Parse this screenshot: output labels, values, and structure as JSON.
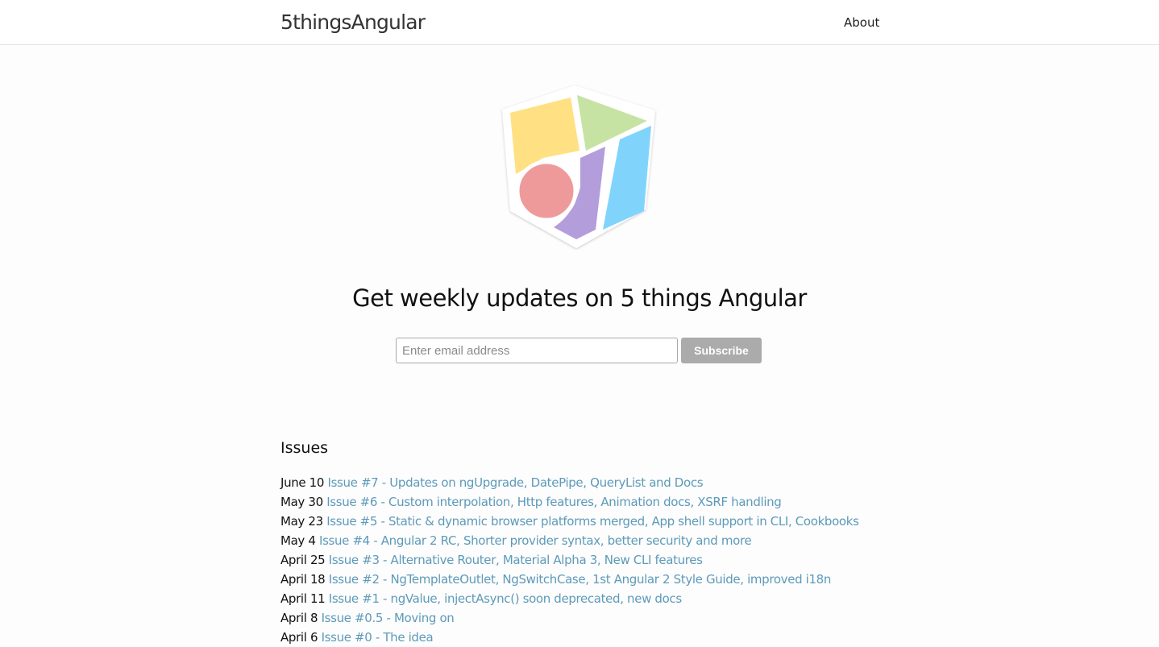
{
  "header": {
    "site_title": "5thingsAngular",
    "nav": [
      {
        "label": "About"
      }
    ]
  },
  "logo": {
    "colors": {
      "yellow": "#ffe083",
      "green": "#c6e3a4",
      "blue": "#80d4fc",
      "purple": "#b39ddb",
      "red": "#ef9a9a",
      "outline": "#ffffff"
    }
  },
  "hero": {
    "headline": "Get weekly updates on 5 things Angular"
  },
  "subscribe": {
    "email_placeholder": "Enter email address",
    "email_value": "",
    "button_label": "Subscribe",
    "button_color": "#ababab"
  },
  "issues": {
    "heading": "Issues",
    "link_color": "#5d9ab9",
    "items": [
      {
        "date": "June 10",
        "title": "Issue #7 - Updates on ngUpgrade, DatePipe, QueryList and Docs"
      },
      {
        "date": "May 30",
        "title": "Issue #6 - Custom interpolation, Http features, Animation docs, XSRF handling"
      },
      {
        "date": "May 23",
        "title": "Issue #5 - Static & dynamic browser platforms merged, App shell support in CLI, Cookbooks"
      },
      {
        "date": "May 4",
        "title": "Issue #4 - Angular 2 RC, Shorter provider syntax, better security and more"
      },
      {
        "date": "April 25",
        "title": "Issue #3 - Alternative Router, Material Alpha 3, New CLI features"
      },
      {
        "date": "April 18",
        "title": "Issue #2 - NgTemplateOutlet, NgSwitchCase, 1st Angular 2 Style Guide, improved i18n"
      },
      {
        "date": "April 11",
        "title": "Issue #1 - ngValue, injectAsync() soon deprecated, new docs"
      },
      {
        "date": "April 8",
        "title": "Issue #0.5 - Moving on"
      },
      {
        "date": "April 6",
        "title": "Issue #0 - The idea"
      }
    ]
  }
}
